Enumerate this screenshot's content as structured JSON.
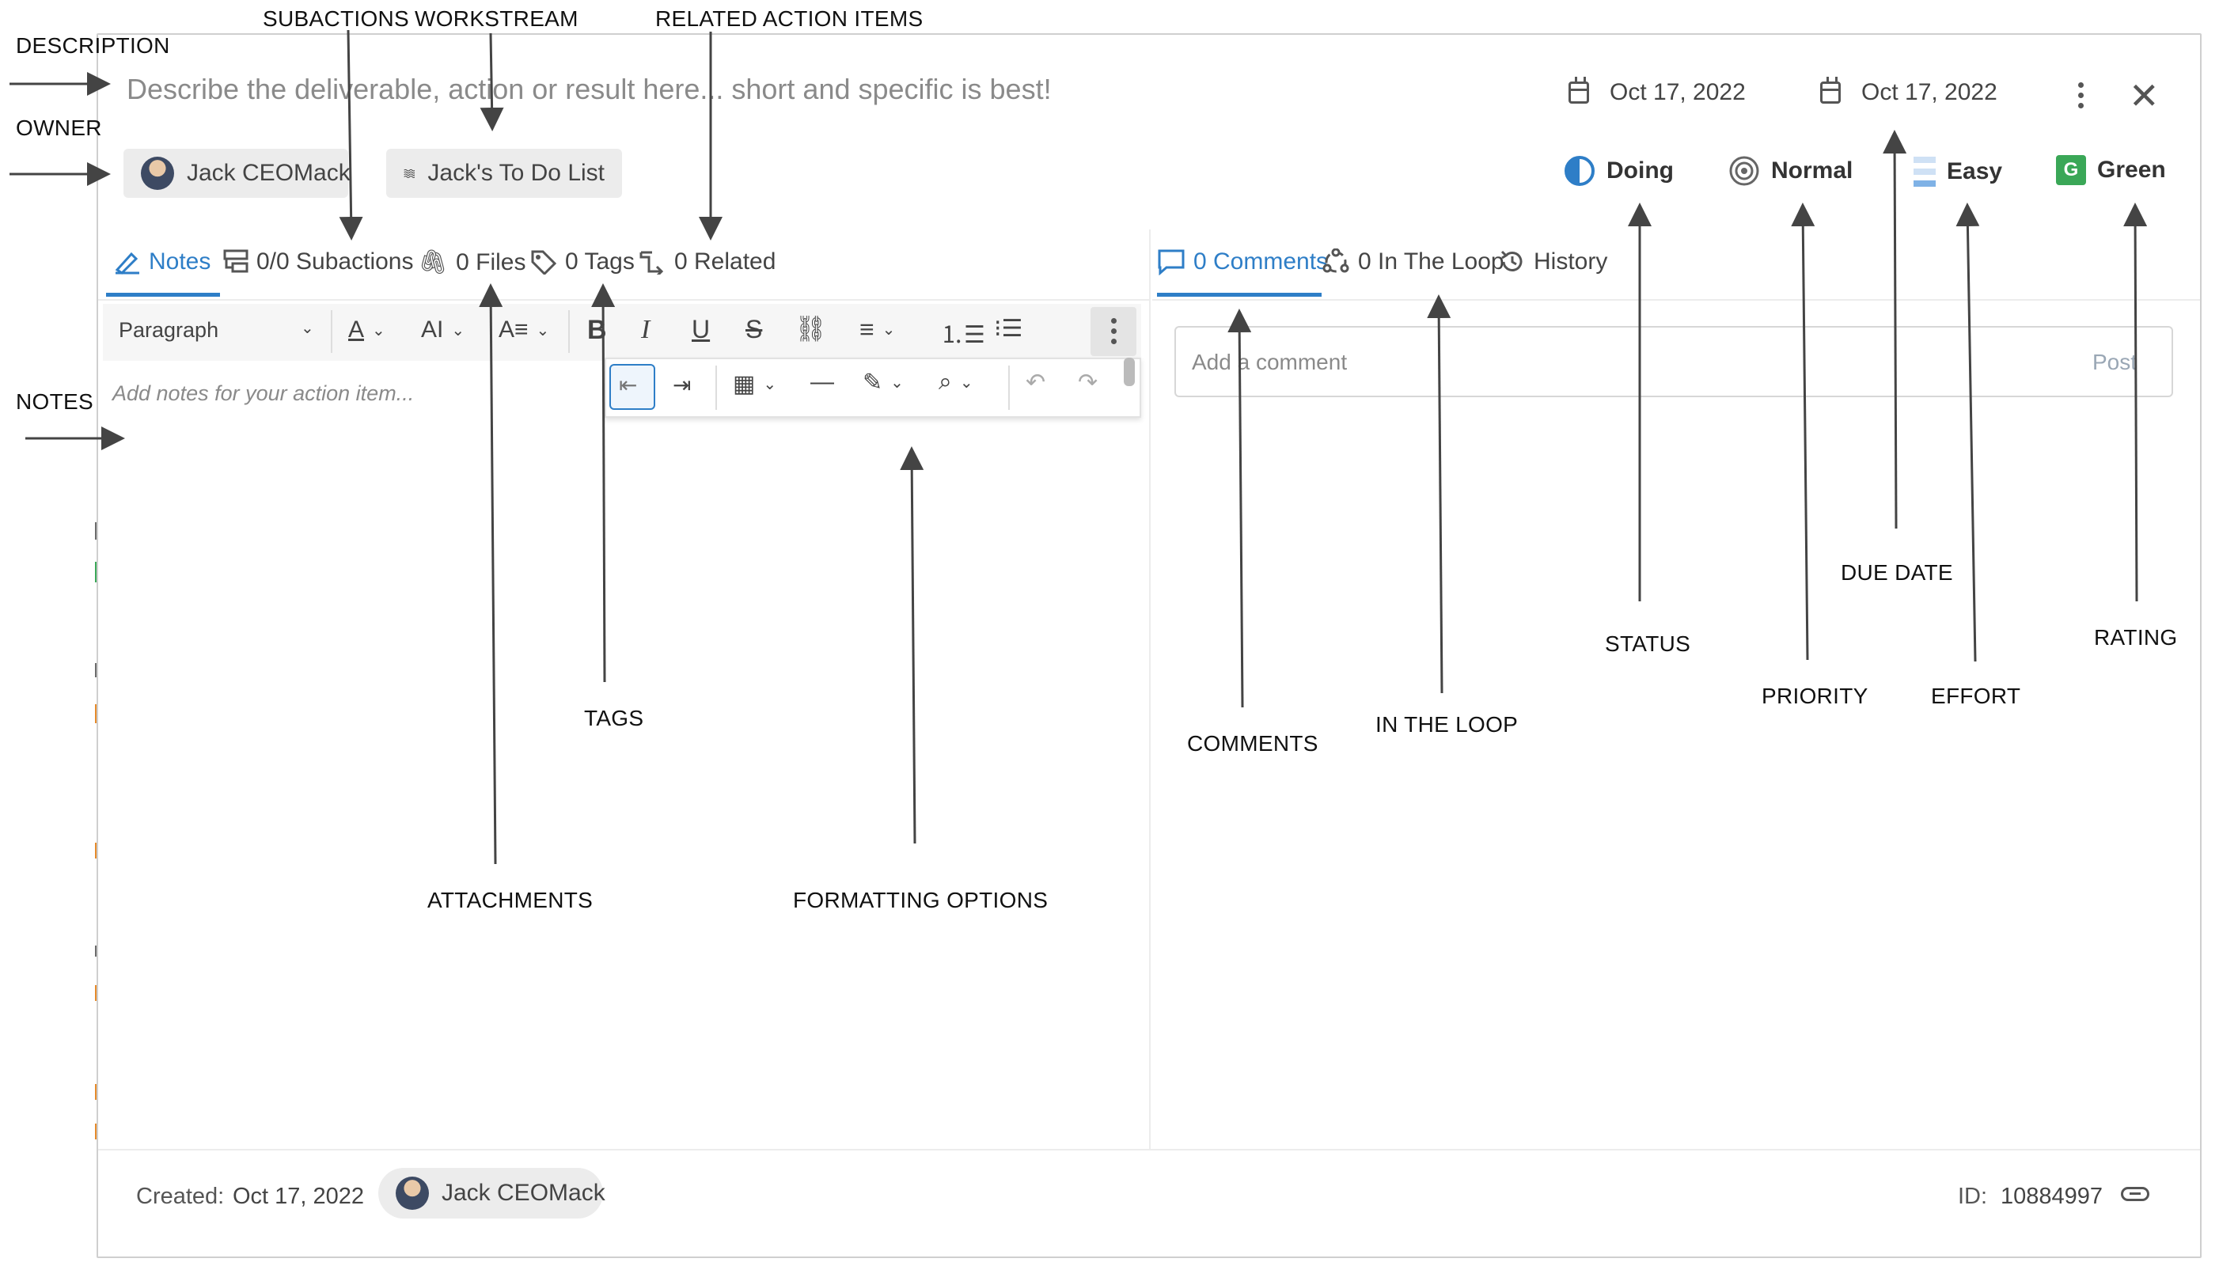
{
  "annotations": {
    "description": "DESCRIPTION",
    "owner": "OWNER",
    "notes": "NOTES",
    "subactions": "SUBACTIONS",
    "workstream": "WORKSTREAM",
    "related_action_items": "RELATED ACTION ITEMS",
    "tags": "TAGS",
    "attachments": "ATTACHMENTS",
    "formatting_options": "FORMATTING OPTIONS",
    "comments": "COMMENTS",
    "in_the_loop": "IN THE LOOP",
    "status": "STATUS",
    "priority": "PRIORITY",
    "due_date": "DUE DATE",
    "effort": "EFFORT",
    "rating": "RATING"
  },
  "description": {
    "placeholder": "Describe the deliverable, action or result here... short and specific is best!"
  },
  "dates": {
    "start": "Oct 17, 2022",
    "due": "Oct 17, 2022"
  },
  "owner": {
    "name": "Jack CEOMack"
  },
  "workstream": {
    "name": "Jack's To Do List"
  },
  "status": {
    "label": "Doing",
    "color": "#2e7ec7"
  },
  "priority": {
    "label": "Normal"
  },
  "effort": {
    "label": "Easy"
  },
  "rating": {
    "letter": "G",
    "label": "Green",
    "color": "#3aa757"
  },
  "tabs_left": [
    {
      "label": "Notes",
      "icon": "notes-icon"
    },
    {
      "label": "0/0 Subactions",
      "icon": "subactions-icon"
    },
    {
      "label": "0 Files",
      "icon": "paperclip-icon"
    },
    {
      "label": "0 Tags",
      "icon": "tag-icon"
    },
    {
      "label": "0 Related",
      "icon": "related-icon"
    }
  ],
  "tabs_right": [
    {
      "label": "0 Comments",
      "icon": "comment-icon"
    },
    {
      "label": "0 In The Loop",
      "icon": "loop-icon"
    },
    {
      "label": "History",
      "icon": "history-icon"
    }
  ],
  "editor": {
    "paragraph": "Paragraph",
    "notes_placeholder": "Add notes for your action item..."
  },
  "comments": {
    "placeholder": "Add a comment",
    "post": "Post"
  },
  "footer": {
    "created_label": "Created:",
    "created_date": "Oct 17, 2022",
    "creator": "Jack CEOMack",
    "id_label": "ID:",
    "id_value": "10884997"
  },
  "accent": "#2e7ec7"
}
